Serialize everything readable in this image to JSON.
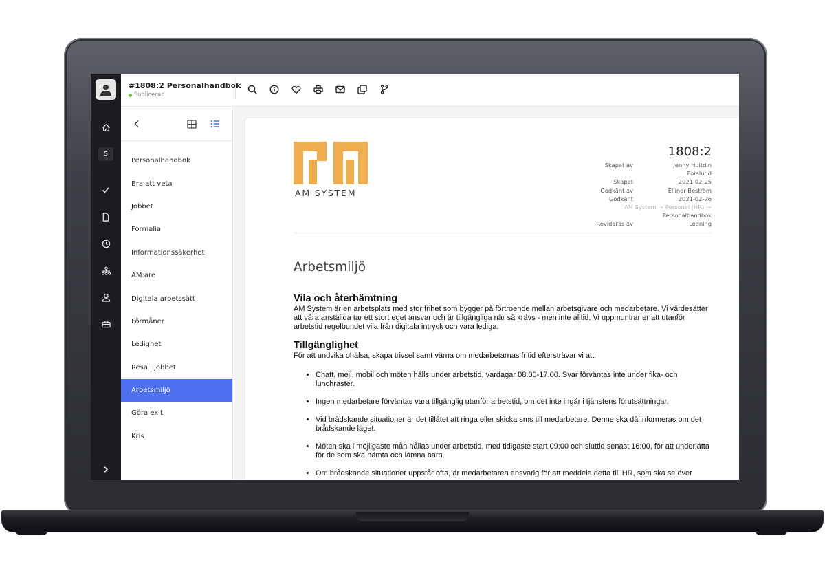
{
  "header": {
    "title": "#1808:2 Personalhandbok",
    "status": "Publicerad",
    "status_color": "#6cc04a",
    "toolbar": [
      {
        "name": "search-icon",
        "label": "Sök"
      },
      {
        "name": "info-icon",
        "label": "Info"
      },
      {
        "name": "heart-icon",
        "label": "Favorit"
      },
      {
        "name": "print-icon",
        "label": "Skriv ut"
      },
      {
        "name": "mail-icon",
        "label": "E-post"
      },
      {
        "name": "copy-icon",
        "label": "Kopiera"
      },
      {
        "name": "branch-icon",
        "label": "Versioner"
      }
    ]
  },
  "rail": {
    "badge_count": "5",
    "icons": [
      "home-icon",
      "check-icon",
      "document-icon",
      "clock-icon",
      "org-chart-icon",
      "user-icon",
      "briefcase-icon"
    ],
    "expand_icon": "chevron-right-icon"
  },
  "nav": {
    "items": [
      {
        "label": "Personalhandbok",
        "active": false
      },
      {
        "label": "Bra att veta",
        "active": false
      },
      {
        "label": "Jobbet",
        "active": false
      },
      {
        "label": "Formalia",
        "active": false
      },
      {
        "label": "Informationssäkerhet",
        "active": false
      },
      {
        "label": "AM:are",
        "active": false
      },
      {
        "label": "Digitala arbetssätt",
        "active": false
      },
      {
        "label": "Förmåner",
        "active": false
      },
      {
        "label": "Ledighet",
        "active": false
      },
      {
        "label": "Resa i jobbet",
        "active": false
      },
      {
        "label": "Arbetsmiljö",
        "active": true
      },
      {
        "label": "Göra exit",
        "active": false
      },
      {
        "label": "Kris",
        "active": false
      }
    ],
    "active_color": "#4f71f0"
  },
  "document": {
    "logo_text": "AM SYSTEM",
    "logo_color": "#f0ad4e",
    "registered_mark": "®",
    "number": "1808:2",
    "meta": {
      "created_by_label": "Skapat av",
      "created_by_line1": "Jenny Hultdin",
      "created_by_line2": "Forslund",
      "created_label": "Skapat",
      "created": "2021-02-25",
      "approved_by_label": "Godkänt av",
      "approved_by": "Ellinor Boström",
      "approved_label": "Godkänt",
      "approved": "2021-02-26",
      "path": "AM System -» Personal (HR) -»",
      "path_end": "Personalhandbok",
      "revised_by_label": "Revideras av",
      "revised_by": "Ledning"
    },
    "title": "Arbetsmiljö",
    "sections": [
      {
        "heading": "Vila och återhämtning",
        "text": "AM System är en arbetsplats med stor frihet som bygger på förtroende mellan arbetsgivare och medarbetare. Vi värdesätter att våra anställda tar ett stort eget ansvar och är tillgängliga när så krävs - men inte alltid. Vi uppmuntrar er att utanför arbetstid regelbundet vila från digitala intryck och vara lediga."
      },
      {
        "heading": "Tillgänglighet",
        "text": "För att undvika ohälsa, skapa trivsel samt värna om medarbetarnas fritid eftersträvar vi att:"
      }
    ],
    "bullets": [
      "Chatt, mejl, mobil och möten hålls under arbetstid, vardagar 08.00-17.00. Svar förväntas inte under fika- och lunchraster.",
      "Ingen medarbetare förväntas vara tillgänglig utanför arbetstid, om det inte ingår i tjänstens förutsättningar.",
      "Vid brådskande situationer är det tillåtet att ringa eller skicka sms till medarbetare. Denne ska då informeras om det brådskande läget.",
      "Möten ska i möjligaste mån hållas under arbetstid, med tidigaste start 09:00 och sluttid senast 16:00, för att underlätta för de som ska hämta och lämna barn.",
      "Om brådskande situationer uppstår ofta, är medarbetaren ansvarig för att meddela detta till HR, som ska se över"
    ]
  }
}
